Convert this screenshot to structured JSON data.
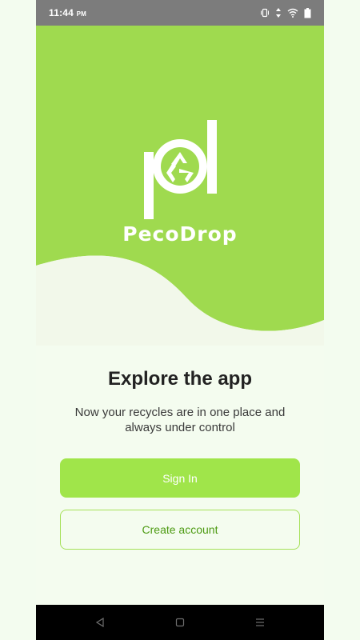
{
  "status_bar": {
    "time": "11:44",
    "ampm": "PM",
    "icons": [
      "vibrate-icon",
      "data-arrows-icon",
      "wifi-icon",
      "battery-icon"
    ]
  },
  "brand": {
    "name": "PecoDrop",
    "logo_icon": "pd-recycle-logo-icon"
  },
  "main": {
    "title": "Explore the app",
    "subtitle": "Now your recycles are in one place and always under control"
  },
  "buttons": {
    "sign_in": "Sign In",
    "create_account": "Create account"
  },
  "nav_bar": {
    "items": [
      "back-icon",
      "home-icon",
      "menu-icon"
    ]
  },
  "colors": {
    "brand_green": "#9fda4f",
    "button_green": "#a0e54a",
    "text_green": "#4c9a12",
    "background": "#f4fcef"
  }
}
